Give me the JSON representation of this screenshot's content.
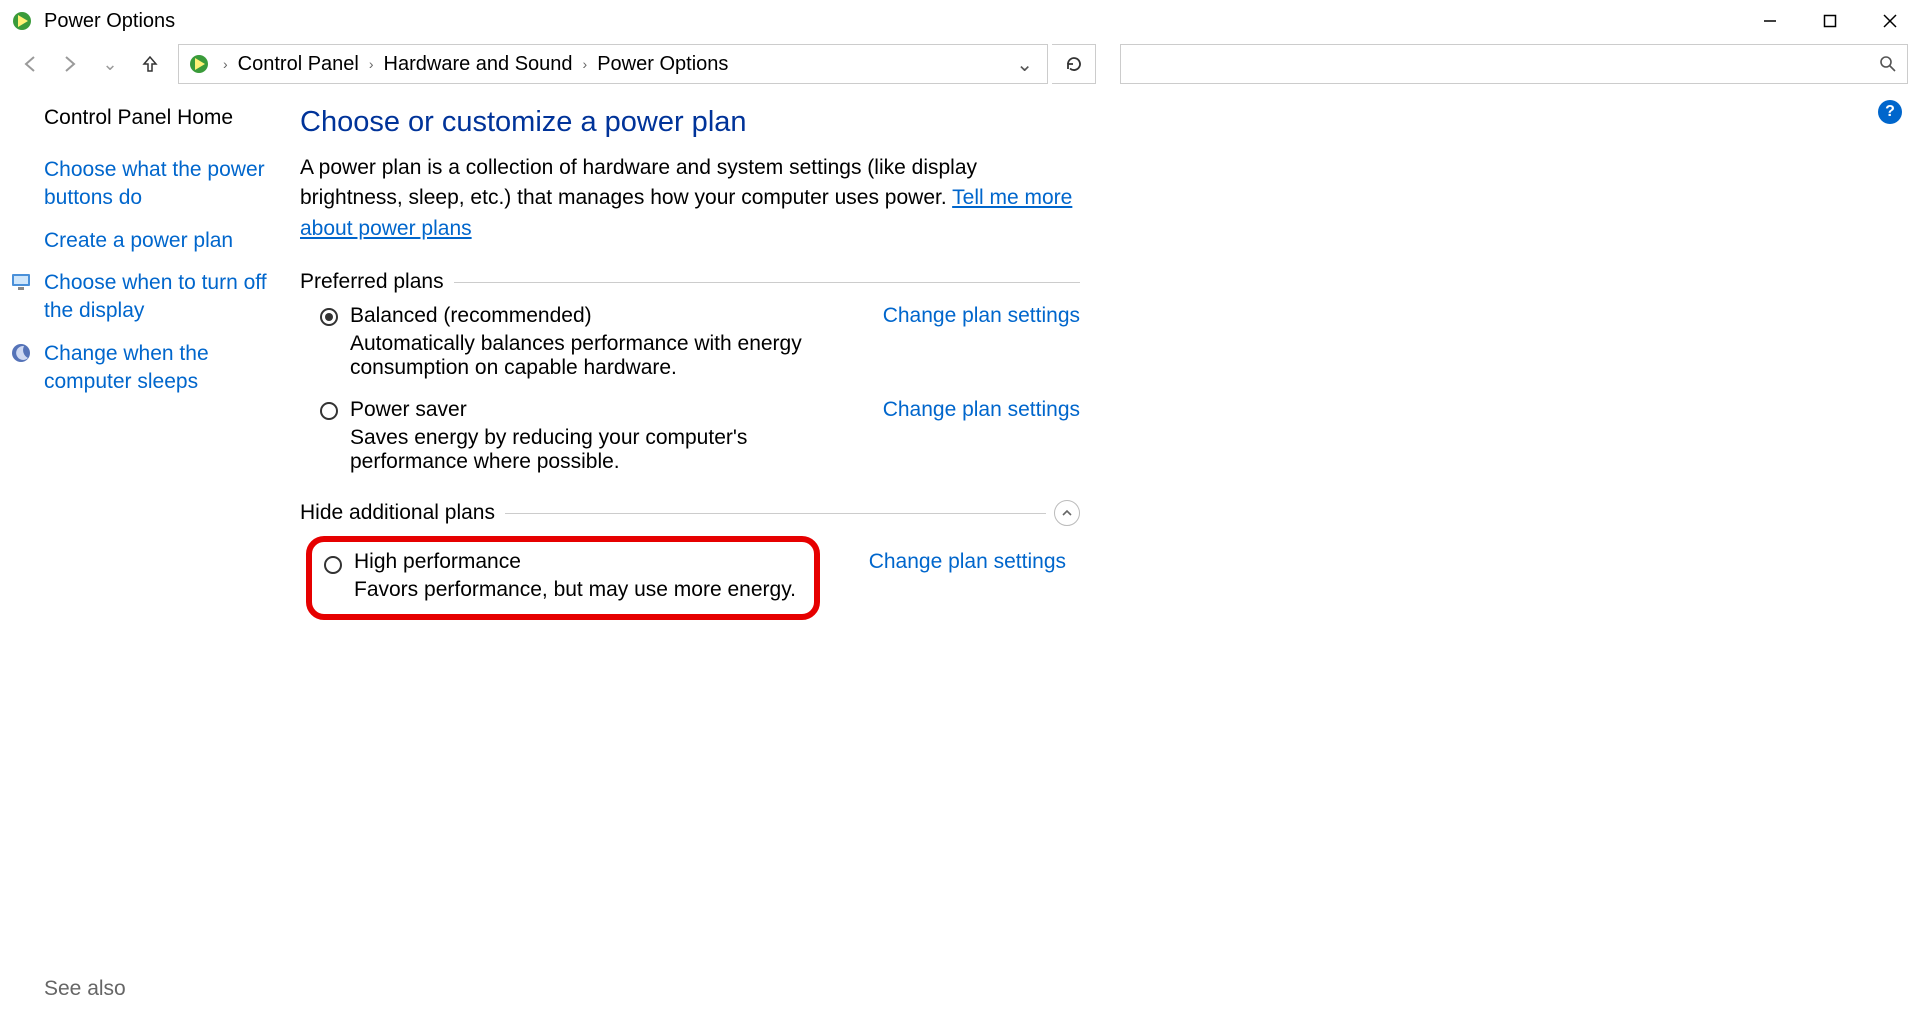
{
  "window": {
    "title": "Power Options"
  },
  "breadcrumb": {
    "root": "Control Panel",
    "mid": "Hardware and Sound",
    "leaf": "Power Options"
  },
  "sidebar": {
    "home": "Control Panel Home",
    "links": [
      {
        "label": "Choose what the power buttons do",
        "icon": null
      },
      {
        "label": "Create a power plan",
        "icon": null
      },
      {
        "label": "Choose when to turn off the display",
        "icon": "monitor"
      },
      {
        "label": "Change when the computer sleeps",
        "icon": "moon"
      }
    ],
    "see_also": "See also"
  },
  "main": {
    "heading": "Choose or customize a power plan",
    "desc_pre": "A power plan is a collection of hardware and system settings (like display brightness, sleep, etc.) that manages how your computer uses power. ",
    "desc_link": "Tell me more about power plans",
    "preferred_label": "Preferred plans",
    "additional_label": "Hide additional plans",
    "change_link": "Change plan settings",
    "plans_preferred": [
      {
        "name": "Balanced (recommended)",
        "desc": "Automatically balances performance with energy consumption on capable hardware.",
        "selected": true
      },
      {
        "name": "Power saver",
        "desc": "Saves energy by reducing your computer's performance where possible.",
        "selected": false
      }
    ],
    "plans_additional": [
      {
        "name": "High performance",
        "desc": "Favors performance, but may use more energy.",
        "selected": false
      }
    ]
  }
}
